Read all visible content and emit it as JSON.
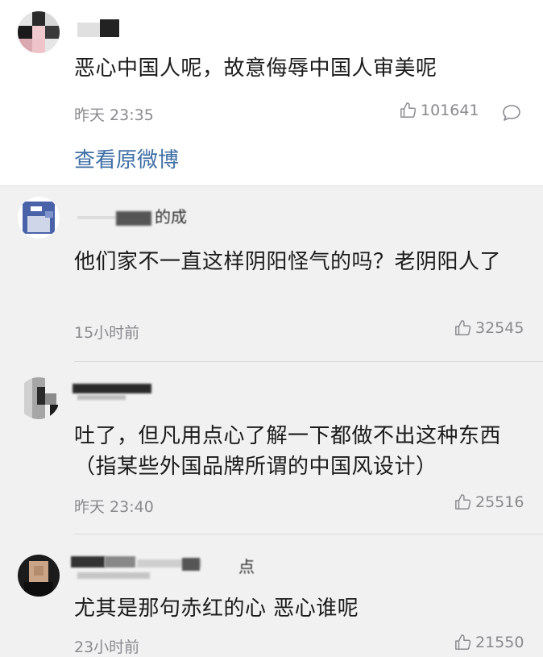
{
  "comments": [
    {
      "text": "恶心中国人呢，故意侮辱中国人审美呢",
      "time": "昨天 23:35",
      "likes": "101641",
      "action": "查看原微博",
      "name_tail": ""
    },
    {
      "text": "他们家不一直这样阴阳怪气的吗？老阴阳人了",
      "time": "15小时前",
      "likes": "32545",
      "name_tail": "的成"
    },
    {
      "text": "吐了，但凡用点心了解一下都做不出这种东西（指某些外国品牌所谓的中国风设计）",
      "time": "昨天 23:40",
      "likes": "25516",
      "name_tail": ""
    },
    {
      "text": "尤其是那句赤红的心 恶心谁呢",
      "time": "23小时前",
      "likes": "21550",
      "name_tail": "点"
    }
  ],
  "icons": {
    "like": "thumbs-up-icon",
    "reply": "speech-bubble-icon"
  },
  "colors": {
    "link": "#3e6fa6",
    "meta": "#8a8a8e",
    "background": "#f1f1f2"
  }
}
